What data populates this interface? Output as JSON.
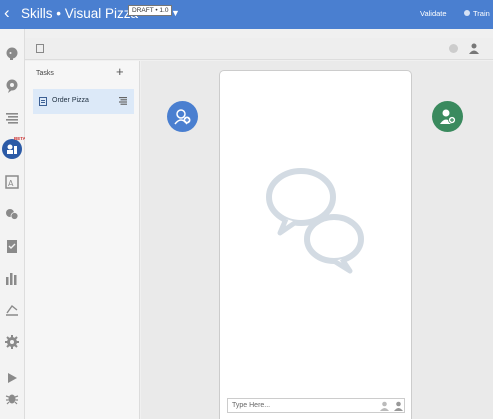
{
  "header": {
    "back_icon": "chevron-left-icon",
    "title": "Skills • Visual Pizza",
    "badge": "DRAFT • 1.0",
    "dropdown_icon": "caret-down-icon",
    "validate_label": "Validate",
    "train_label": "Train",
    "accent": "#4a7fd0"
  },
  "leftnav": {
    "items": [
      "intent-icon",
      "entity-icon",
      "resource-bundle-icon",
      "flow-designer-icon",
      "translate-icon",
      "channels-icon",
      "quality-icon",
      "insights-icon",
      "ai-icon",
      "settings-icon",
      "preview-icon",
      "debug-icon"
    ],
    "beta_label": "BETA"
  },
  "tasks": {
    "header": "Tasks",
    "add_icon": "plus-icon",
    "items": [
      {
        "label": "Order Pizza",
        "icon": "flow-icon",
        "menu_icon": "hamburger-icon"
      }
    ],
    "selected_color": "#dce9f8"
  },
  "canvas": {
    "bot_button_icon": "add-bot-icon",
    "user_button_icon": "add-user-icon",
    "bot_color": "#4a7fd0",
    "user_color": "#3a8a5e"
  },
  "chat": {
    "placeholder": "Type Here...",
    "empty_icon": "chat-bubbles-icon"
  }
}
